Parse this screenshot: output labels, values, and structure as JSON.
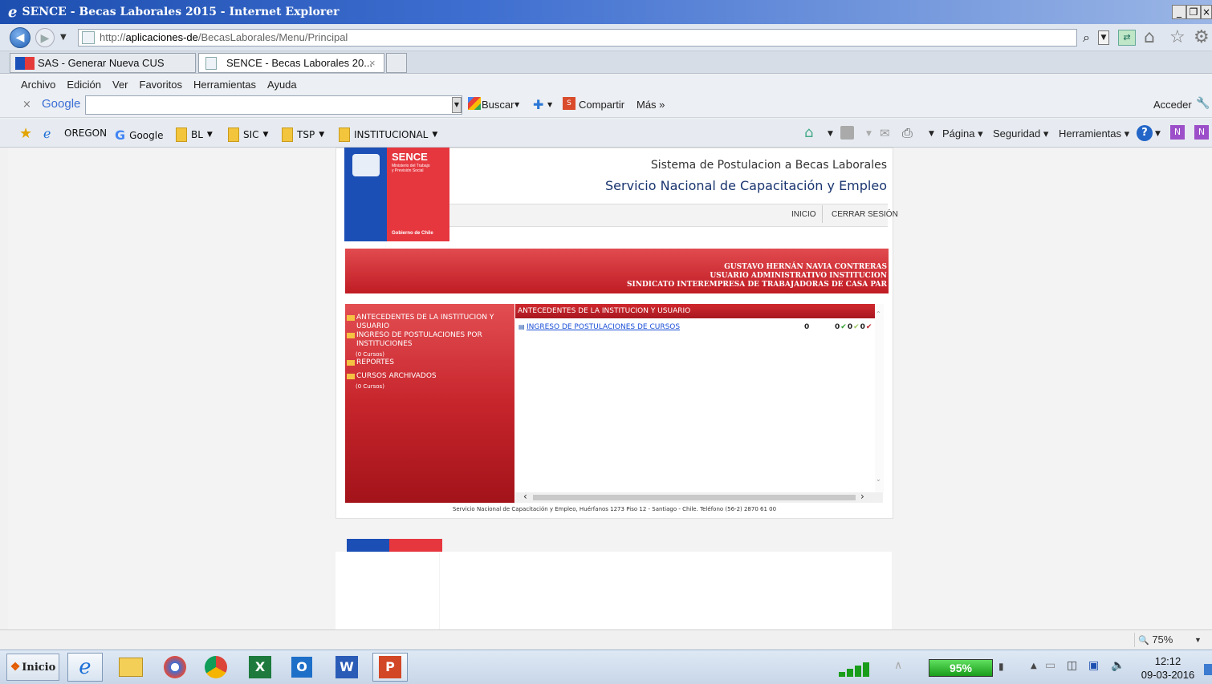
{
  "window": {
    "title": "SENCE - Becas Laborales 2015 - Internet Explorer",
    "min_btn": "_",
    "max_btn": "❐",
    "close_btn": "×"
  },
  "address": {
    "url_prefix": "http://",
    "url_host": "aplicaciones-de",
    "url_path": "/BecasLaborales/Menu/Principal"
  },
  "tabs": [
    {
      "label": "SAS - Generar Nueva CUS"
    },
    {
      "label": "SENCE - Becas Laborales 20...",
      "close": "×"
    }
  ],
  "menu": [
    "Archivo",
    "Edición",
    "Ver",
    "Favoritos",
    "Herramientas",
    "Ayuda"
  ],
  "google_toolbar": {
    "close": "×",
    "brand": "Google",
    "buscar": "Buscar",
    "compartir": "Compartir",
    "mas": "Más »",
    "acceder": "Acceder"
  },
  "favorites": [
    "OREGON",
    "Google",
    "BL",
    "SIC",
    "TSP",
    "INSTITUCIONAL"
  ],
  "command_bar": [
    "Página",
    "Seguridad",
    "Herramientas"
  ],
  "header": {
    "logo_name": "SENCE",
    "logo_sub1": "Ministerio del Trabajo",
    "logo_sub2": "y Previsión Social",
    "logo_gov": "Gobierno de Chile",
    "system_name": "Sistema de Postulacion a Becas Laborales",
    "service_name": "Servicio Nacional de Capacitación y Empleo",
    "nav_inicio": "INICIO",
    "nav_cerrar": "CERRAR SESIÓN"
  },
  "user": {
    "name": "GUSTAVO HERNÁN NAVIA CONTRERAS",
    "role": "USUARIO ADMINISTRATIVO INSTITUCION",
    "org": "SINDICATO INTEREMPRESA DE TRABAJADORAS DE CASA PAR"
  },
  "sidebar": [
    {
      "label": "ANTECEDENTES DE LA INSTITUCION Y USUARIO",
      "count": ""
    },
    {
      "label": "INGRESO DE POSTULACIONES POR INSTITUCIONES",
      "count": "(0 Cursos)"
    },
    {
      "label": "REPORTES",
      "count": ""
    },
    {
      "label": "CURSOS ARCHIVADOS",
      "count": "(0 Cursos)"
    }
  ],
  "content": {
    "heading": "ANTECEDENTES DE LA INSTITUCION Y USUARIO",
    "row_link": "INGRESO DE POSTULACIONES DE CURSOS",
    "row_count": "0",
    "row_ok1": "0",
    "row_ok2": "0",
    "row_bad": "0"
  },
  "footer": "Servicio Nacional de Capacitación y Empleo, Huérfanos 1273 Piso 12 - Santiago - Chile. Teléfono (56-2) 2870 61 00",
  "status": {
    "zoom": "75%"
  },
  "taskbar": {
    "start": "Inicio",
    "battery": "95%",
    "time": "12:12",
    "date": "09-03-2016"
  },
  "colors": {
    "sence_blue": "#1c4fb5",
    "sence_red": "#e6373f",
    "banner_red": "#c01c24",
    "title_blue": "#1d4fb0"
  }
}
